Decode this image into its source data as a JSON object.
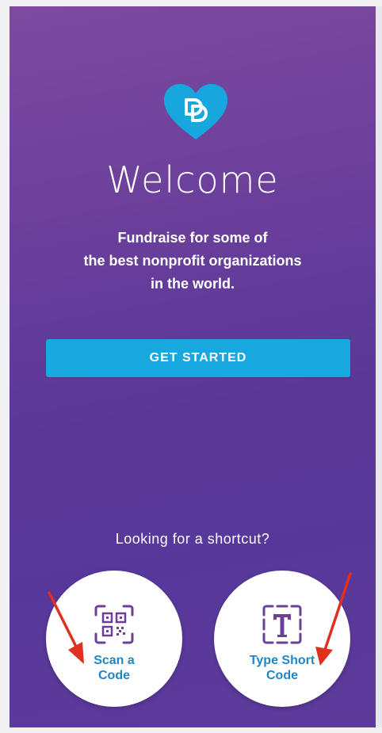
{
  "welcome": {
    "title": "Welcome",
    "subtitle_lines": [
      "Fundraise for some of",
      "the best nonprofit organizations",
      "in the world."
    ],
    "cta_label": "GET STARTED"
  },
  "shortcuts": {
    "prompt": "Looking for a shortcut?",
    "scan": {
      "label_lines": [
        "Scan a",
        "Code"
      ],
      "icon": "qr-code-icon"
    },
    "type": {
      "label_lines": [
        "Type Short",
        "Code"
      ],
      "icon": "text-t-icon"
    }
  },
  "colors": {
    "accent_blue": "#17a8df",
    "label_blue": "#1f86c6",
    "icon_purple": "#6b3f98",
    "background_purple": "#6a3f9b",
    "annotation_red": "#e0301e"
  }
}
